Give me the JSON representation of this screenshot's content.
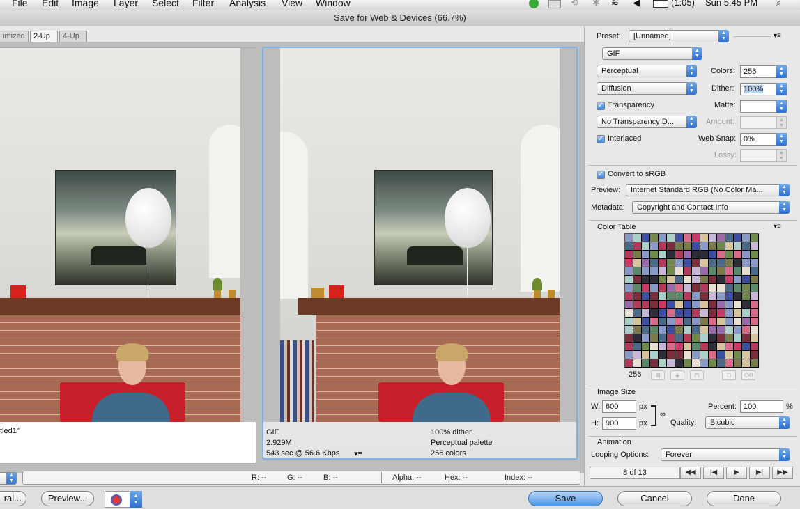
{
  "menubar": {
    "items": [
      "File",
      "Edit",
      "Image",
      "Layer",
      "Select",
      "Filter",
      "Analysis",
      "View",
      "Window"
    ],
    "battery": "(1:05)",
    "clock": "Sun 5:45 PM"
  },
  "window": {
    "title": "Save for Web & Devices (66.7%)"
  },
  "tabs": [
    {
      "label": "imized"
    },
    {
      "label": "2-Up"
    },
    {
      "label": "4-Up"
    }
  ],
  "left_pane": {
    "caption": "tled1\""
  },
  "right_pane": {
    "format": "GIF",
    "size": "2.929M",
    "time": "543 sec @ 56.6 Kbps",
    "dither": "100% dither",
    "palette": "Perceptual palette",
    "colors": "256 colors"
  },
  "infobar": {
    "r": "R: --",
    "g": "G: --",
    "b": "B: --",
    "alpha": "Alpha: --",
    "hex": "Hex: --",
    "index": "Index: --"
  },
  "panel": {
    "preset_label": "Preset:",
    "preset_value": "[Unnamed]",
    "format": "GIF",
    "reduction": "Perceptual",
    "colors_label": "Colors:",
    "colors_value": "256",
    "dither_algo": "Diffusion",
    "dither_label": "Dither:",
    "dither_value": "100%",
    "transparency_label": "Transparency",
    "matte_label": "Matte:",
    "trans_dither": "No Transparency D...",
    "amount_label": "Amount:",
    "interlaced_label": "Interlaced",
    "websnap_label": "Web Snap:",
    "websnap_value": "0%",
    "lossy_label": "Lossy:",
    "srgb_label": "Convert to sRGB",
    "preview_label": "Preview:",
    "preview_value": "Internet Standard RGB (No Color Ma...",
    "metadata_label": "Metadata:",
    "metadata_value": "Copyright and Contact Info",
    "color_table_label": "Color Table",
    "color_count": "256",
    "image_size_label": "Image Size",
    "w_label": "W:",
    "w_value": "600",
    "h_label": "H:",
    "h_value": "900",
    "px": "px",
    "percent_label": "Percent:",
    "percent_value": "100",
    "percent_sign": "%",
    "quality_label": "Quality:",
    "quality_value": "Bicubic",
    "animation_label": "Animation",
    "looping_label": "Looping Options:",
    "looping_value": "Forever",
    "frame": "8 of 13"
  },
  "buttons": {
    "device_central": "ral...",
    "preview": "Preview...",
    "save": "Save",
    "cancel": "Cancel",
    "done": "Done"
  },
  "icons": [
    "adobe-icon",
    "wifi-icon",
    "bluetooth-icon",
    "volume-icon",
    "battery-icon",
    "search-icon",
    "time-machine-icon",
    "browser-icon",
    "chain-link-icon",
    "flyout-menu-icon",
    "first-frame-icon",
    "prev-frame-icon",
    "play-icon",
    "next-frame-icon",
    "last-frame-icon"
  ]
}
